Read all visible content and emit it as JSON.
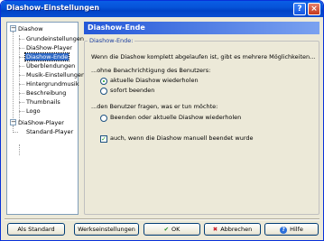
{
  "window": {
    "title": "Diashow-Einstellungen",
    "help_symbol": "?",
    "close_symbol": "×"
  },
  "tree": {
    "items": [
      {
        "label": "Diashow"
      },
      {
        "label": "Grundeinstellungen"
      },
      {
        "label": "DiaShow-Player"
      },
      {
        "label": "Diashow-Ende"
      },
      {
        "label": "Überblendungen"
      },
      {
        "label": "Musik-Einstellungen"
      },
      {
        "label": "Hintergrundmusik"
      },
      {
        "label": "Beschreibung"
      },
      {
        "label": "Thumbnails"
      },
      {
        "label": "Logo"
      },
      {
        "label": "DiaShow-Player"
      },
      {
        "label": "Standard-Player"
      }
    ],
    "selected_index": 3
  },
  "panel": {
    "header": "Diashow-Ende",
    "group_title": "Diashow-Ende:",
    "intro": "Wenn die Diashow komplett abgelaufen ist, gibt es mehrere Möglichkeiten...",
    "section1": "...ohne Benachrichtigung des Benutzers:",
    "option_repeat": "aktuelle Diashow wiederholen",
    "option_quit": "sofort beenden",
    "section2": "...den Benutzer fragen, was er tun möchte:",
    "option_ask": "Beenden oder aktuelle Diashow wiederholen",
    "checkbox_manual": "auch, wenn die Diashow manuell beendet wurde",
    "selected_option": "aktuelle Diashow wiederholen",
    "checkbox_checked": true
  },
  "buttons": {
    "as_default": "Als Standard",
    "factory": "Werkseinstellungen",
    "ok": "OK",
    "cancel": "Abbrechen",
    "help": "Hilfe",
    "ok_glyph": "✔",
    "cancel_glyph": "✖",
    "help_glyph": "?"
  }
}
